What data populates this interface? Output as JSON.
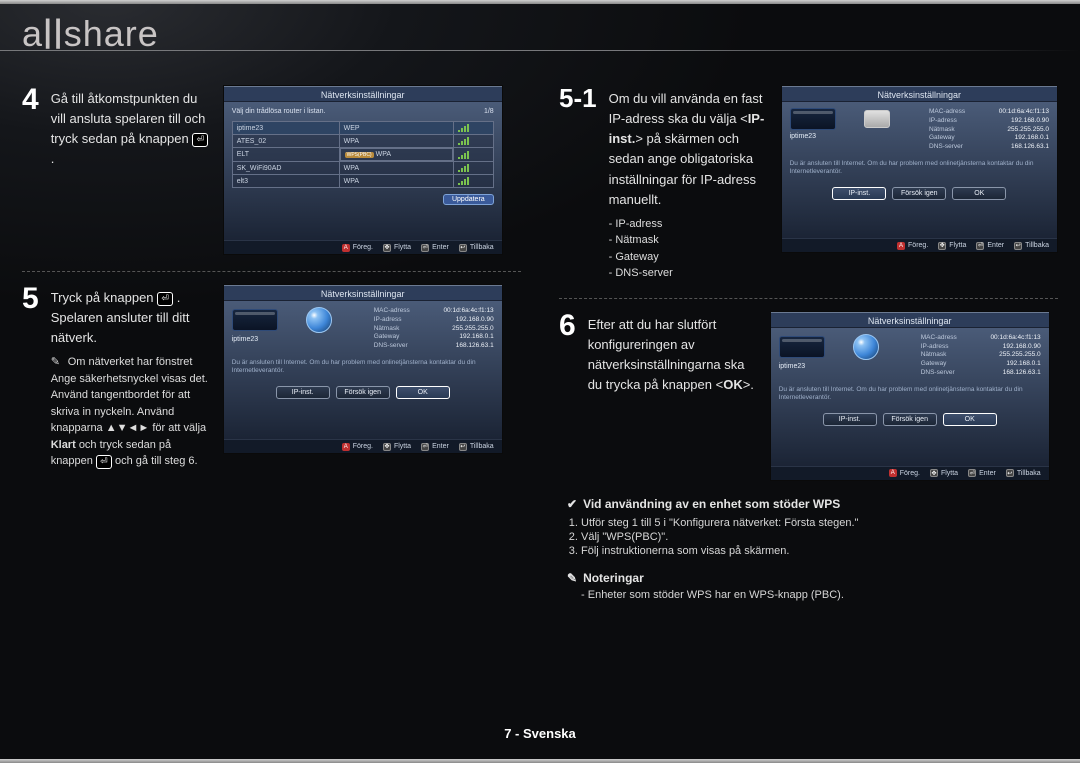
{
  "logo": "allshare",
  "page_footer": "7 - Svenska",
  "screens": {
    "title": "Nätverksinställningar",
    "footer_items": [
      "Föreg.",
      "Flytta",
      "Enter",
      "Tillbaka"
    ],
    "footer_badges": [
      "A",
      "◄►",
      "⏎",
      "↩"
    ]
  },
  "step4": {
    "num": "4",
    "text_parts": [
      "Gå till åtkomstpunkten du vill ansluta spelaren till och tryck sedan på knappen ",
      "."
    ],
    "screen_hint": "Välj din trådlösa router i listan.",
    "screen_page": "1/8",
    "rows": [
      {
        "name": "iptime23",
        "sec": "WEP",
        "sel": true
      },
      {
        "name": "ATES_02",
        "sec": "WPA",
        "sel": false
      },
      {
        "name": "ELT",
        "sec": "WPA",
        "sel": false
      },
      {
        "name": "SK_WiFi90AD",
        "sec": "WPA",
        "sel": false
      },
      {
        "name": "elt3",
        "sec": "WPA",
        "sel": false
      }
    ],
    "update_btn": "Uppdatera"
  },
  "step5": {
    "num": "5",
    "text_parts": [
      "Tryck på knappen ",
      ". Spelaren ansluter till ditt nätverk."
    ],
    "sub": {
      "lines": [
        "Om nätverket har fönstret Ange säkerhetsnyckel visas det. Använd tangentbordet för att skriva in nyckeln. Använd knapparna ▲▼◄► för att välja ",
        " och tryck sedan på knappen ",
        " och gå till steg 6."
      ],
      "bold_word": "Klart"
    }
  },
  "step5_1": {
    "num": "5-1",
    "text_parts": [
      "Om du vill använda en fast IP-adress ska du välja <",
      "> på skärmen och sedan ange obligatoriska inställningar för IP-adress manuellt."
    ],
    "bold_word": "IP-inst.",
    "bullets": [
      "IP-adress",
      "Nätmask",
      "Gateway",
      "DNS-server"
    ]
  },
  "step6": {
    "num": "6",
    "text": "Efter att du har slutfört konfigureringen av nätverksinställningarna ska du trycka på knappen <",
    "bold_word": "OK",
    "text_after": ">."
  },
  "info_screen": {
    "ssid": "iptime23",
    "kv": [
      {
        "k": "MAC-adress",
        "v": "00:1d:6a:4c:f1:13"
      },
      {
        "k": "IP-adress",
        "v": "192.168.0.90"
      },
      {
        "k": "Nätmask",
        "v": "255.255.255.0"
      },
      {
        "k": "Gateway",
        "v": "192.168.0.1"
      },
      {
        "k": "DNS-server",
        "v": "168.126.63.1"
      }
    ],
    "msg": "Du är ansluten till Internet. Om du har problem med onlinetjänsterna kontaktar du din Internetleverantör.",
    "buttons": [
      "IP-inst.",
      "Försök igen",
      "OK"
    ]
  },
  "wps": {
    "heading": "Vid användning av en enhet som stöder WPS",
    "items": [
      "Utför steg 1 till 5 i \"Konfigurera nätverket: Första stegen.\"",
      "Välj \"WPS(PBC)\".",
      "Följ instruktionerna som visas på skärmen."
    ],
    "note_heading": "Noteringar",
    "note_line": "Enheter som stöder WPS har en WPS-knapp (PBC)."
  }
}
